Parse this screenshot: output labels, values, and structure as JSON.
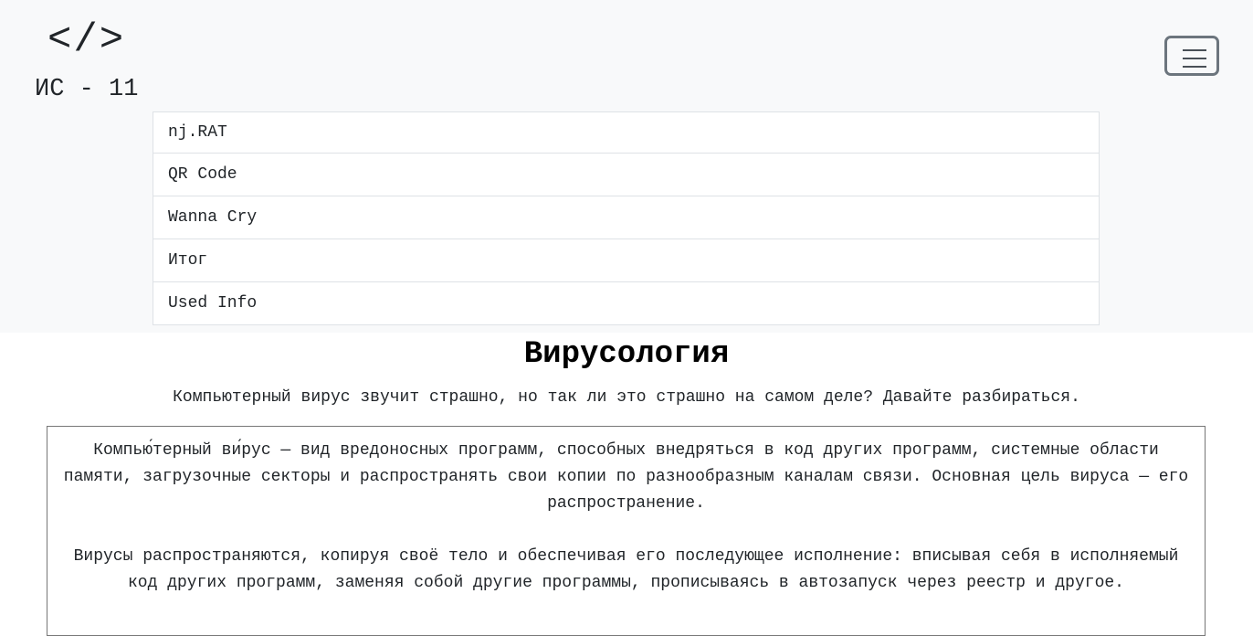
{
  "header": {
    "logo": "</>",
    "brand": "ИС - 11",
    "menu_icon": "hamburger-icon"
  },
  "nav": {
    "items": [
      {
        "label": "nj.RAT"
      },
      {
        "label": "QR Code"
      },
      {
        "label": "Wanna Cry"
      },
      {
        "label": "Итог"
      },
      {
        "label": "Used Info"
      }
    ]
  },
  "main": {
    "title": "Вирусология",
    "lead": "Компьютерный вирус звучит страшно, но так ли это страшно на самом деле? Давайте разбираться.",
    "paragraphs": [
      "Компью́терный ви́рус — вид вредоносных программ, способных внедряться в код других программ, системные области памяти, загрузочные секторы и распространять свои копии по разнообразным каналам связи. Основная цель вируса — его распространение.",
      "Вирусы распространяются, копируя своё тело и обеспечивая его последующее исполнение: вписывая себя в исполняемый код других программ, заменяя собой другие программы, прописываясь в автозапуск через реестр и другое."
    ]
  }
}
